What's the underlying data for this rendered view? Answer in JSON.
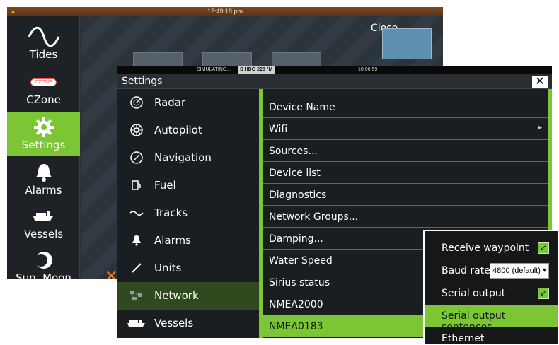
{
  "background_screen": {
    "clock": "12:49:18 pm",
    "close_label": "Close",
    "sidebar": [
      {
        "label": "Tides",
        "icon": "tide-wave-icon"
      },
      {
        "label": "CZone",
        "icon": "czone-logo-icon",
        "logo_text": "CZONE"
      },
      {
        "label": "Settings",
        "icon": "gear-icon",
        "active": true
      },
      {
        "label": "Alarms",
        "icon": "bell-icon"
      },
      {
        "label": "Vessels",
        "icon": "vessel-icon"
      },
      {
        "label": "Sun, Moon",
        "icon": "moon-icon"
      }
    ]
  },
  "settings": {
    "status": {
      "simulating": "SIMULATING...",
      "heading": "S HDG 228 °M",
      "time": "10:00:59"
    },
    "title": "Settings",
    "close_label": "✕",
    "left_items": [
      {
        "label": "Radar",
        "icon": "radar-icon"
      },
      {
        "label": "Autopilot",
        "icon": "autopilot-icon"
      },
      {
        "label": "Navigation",
        "icon": "navigation-icon"
      },
      {
        "label": "Fuel",
        "icon": "fuel-icon"
      },
      {
        "label": "Tracks",
        "icon": "tracks-icon"
      },
      {
        "label": "Alarms",
        "icon": "bell-icon"
      },
      {
        "label": "Units",
        "icon": "units-icon"
      },
      {
        "label": "Network",
        "icon": "network-icon",
        "active": true
      },
      {
        "label": "Vessels",
        "icon": "vessel-icon"
      }
    ],
    "right_items": [
      {
        "label": "Device Name"
      },
      {
        "label": "Wifi",
        "has_arrow": true,
        "arrow": "▸"
      },
      {
        "label": "Sources..."
      },
      {
        "label": "Device list"
      },
      {
        "label": "Diagnostics"
      },
      {
        "label": "Network Groups..."
      },
      {
        "label": "Damping..."
      },
      {
        "label": "Water Speed"
      },
      {
        "label": "Sirius status"
      },
      {
        "label": "NMEA2000"
      },
      {
        "label": "NMEA0183",
        "active": true
      }
    ]
  },
  "nmea_popup": {
    "receive_waypoint": {
      "label": "Receive waypoint",
      "checked": true
    },
    "baud_rate": {
      "label": "Baud rate",
      "value": "4800 (default)"
    },
    "serial_output": {
      "label": "Serial output",
      "checked": true
    },
    "serial_output_sentences": {
      "label": "Serial output sentences..."
    },
    "ethernet": {
      "label": "Ethernet"
    },
    "check_mark": "✓"
  },
  "colors": {
    "accent": "#7cc636",
    "panel": "#1b1e21",
    "active_dark": "#2f4a1e"
  }
}
